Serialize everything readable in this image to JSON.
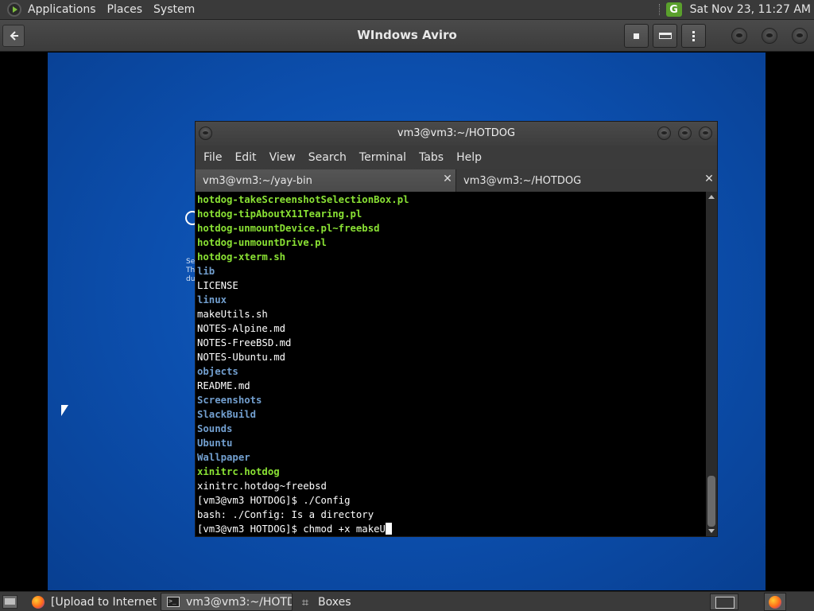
{
  "top_panel": {
    "menus": [
      "Applications",
      "Places",
      "System"
    ],
    "tray_icon_letter": "G",
    "clock": "Sat Nov 23, 11:27 AM"
  },
  "app": {
    "title": "WIndows Aviro",
    "back_icon": "back-arrow-icon",
    "buttons": [
      "stop-icon",
      "keyboard-icon",
      "more-menu-icon"
    ]
  },
  "terminal": {
    "title": "vm3@vm3:~/HOTDOG",
    "menu": [
      "File",
      "Edit",
      "View",
      "Search",
      "Terminal",
      "Tabs",
      "Help"
    ],
    "tabs": [
      {
        "label": "vm3@vm3:~/yay-bin",
        "active": false
      },
      {
        "label": "vm3@vm3:~/HOTDOG",
        "active": true
      }
    ],
    "lines": [
      {
        "text": "hotdog-takeScreenshotSelectionBox.pl",
        "type": "exec"
      },
      {
        "text": "hotdog-tipAboutX11Tearing.pl",
        "type": "exec"
      },
      {
        "text": "hotdog-unmountDevice.pl~freebsd",
        "type": "exec"
      },
      {
        "text": "hotdog-unmountDrive.pl",
        "type": "exec"
      },
      {
        "text": "hotdog-xterm.sh",
        "type": "exec"
      },
      {
        "text": "lib",
        "type": "dir"
      },
      {
        "text": "LICENSE",
        "type": "file"
      },
      {
        "text": "linux",
        "type": "dir"
      },
      {
        "text": "makeUtils.sh",
        "type": "file"
      },
      {
        "text": "NOTES-Alpine.md",
        "type": "file"
      },
      {
        "text": "NOTES-FreeBSD.md",
        "type": "file"
      },
      {
        "text": "NOTES-Ubuntu.md",
        "type": "file"
      },
      {
        "text": "objects",
        "type": "dir"
      },
      {
        "text": "README.md",
        "type": "file"
      },
      {
        "text": "Screenshots",
        "type": "dir"
      },
      {
        "text": "SlackBuild",
        "type": "dir"
      },
      {
        "text": "Sounds",
        "type": "dir"
      },
      {
        "text": "Ubuntu",
        "type": "dir"
      },
      {
        "text": "Wallpaper",
        "type": "dir"
      },
      {
        "text": "xinitrc.hotdog",
        "type": "exec"
      },
      {
        "text": "xinitrc.hotdog~freebsd",
        "type": "file"
      },
      {
        "text": "[vm3@vm3 HOTDOG]$ ./Config",
        "type": "file"
      },
      {
        "text": "bash: ./Config: Is a directory",
        "type": "file"
      }
    ],
    "prompt": "[vm3@vm3 HOTDOG]$ ",
    "input": "chmod +x makeU"
  },
  "vm_screen": {
    "partial_text": [
      "Se",
      "Th",
      "du"
    ]
  },
  "taskbar": {
    "tasks": [
      {
        "label": "[Upload to Internet ...",
        "icon": "firefox-icon"
      },
      {
        "label": "vm3@vm3:~/HOTD...",
        "icon": "terminal-icon",
        "active": true
      },
      {
        "label": "Boxes",
        "icon": "boxes-icon"
      }
    ]
  }
}
